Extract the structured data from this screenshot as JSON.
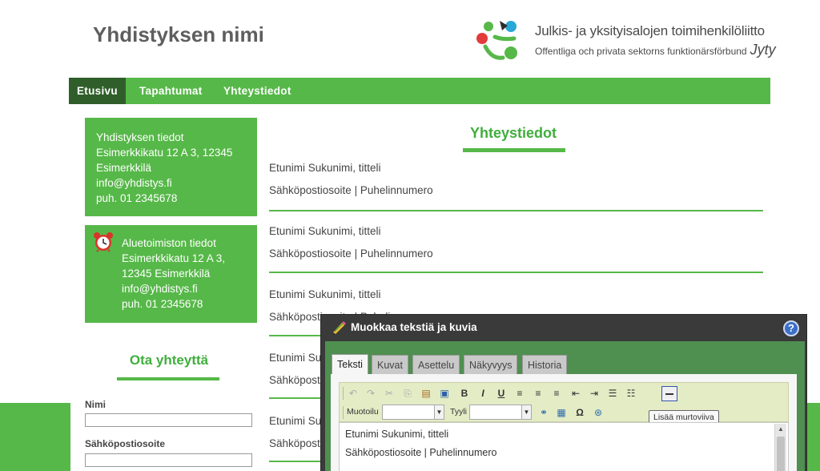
{
  "site": {
    "name": "Yhdistyksen nimi"
  },
  "logo": {
    "line1": "Julkis- ja yksityisalojen toimihenkilöliitto",
    "line2": "Offentliga och privata sektorns funktionärsförbund",
    "brand": "Jyty"
  },
  "nav": {
    "items": [
      "Etusivu",
      "Tapahtumat",
      "Yhteystiedot"
    ]
  },
  "sidebar": {
    "box1": {
      "lines": [
        "Yhdistyksen tiedot",
        "Esimerkkikatu 12 A 3, 12345",
        "Esimerkkilä",
        "info@yhdistys.fi",
        "puh. 01 2345678"
      ]
    },
    "box2": {
      "lines": [
        "Aluetoimiston tiedot",
        "Esimerkkikatu 12 A 3,",
        "12345 Esimerkkilä",
        "info@yhdistys.fi",
        "puh. 01 2345678"
      ]
    },
    "contact_title": "Ota yhteyttä",
    "fields": [
      {
        "label": "Nimi",
        "value": ""
      },
      {
        "label": "Sähköpostiosoite",
        "value": ""
      }
    ]
  },
  "main": {
    "title": "Yhteystiedot",
    "entries": [
      {
        "name": "Etunimi Sukunimi, titteli",
        "contact": "Sähköpostiosoite | Puhelinnumero"
      },
      {
        "name": "Etunimi Sukunimi, titteli",
        "contact": "Sähköpostiosoite | Puhelinnumero"
      },
      {
        "name": "Etunimi Sukunimi, titteli",
        "contact": "Sähköpostiosoite | Puhelinnumero"
      },
      {
        "name": "Etunimi Su",
        "contact": "Sähköpostiosoite"
      },
      {
        "name": "Etunimi Su",
        "contact": "Sähköpost"
      }
    ]
  },
  "editor": {
    "title": "Muokkaa tekstiä ja kuvia",
    "help": "?",
    "tabs": [
      "Teksti",
      "Kuvat",
      "Asettelu",
      "Näkyvyys",
      "Historia"
    ],
    "active_tab": "Teksti",
    "toolbar": {
      "format_label": "Muotoilu",
      "style_label": "Tyyli",
      "tooltip": "Lisää murtoviiva"
    },
    "content": [
      "Etunimi Sukunimi, titteli",
      "Sähköpostiosoite | Puhelinnumero"
    ]
  },
  "colors": {
    "accent": "#56b848",
    "accent_dark": "#2f5e2a",
    "title_green": "#3fae3c",
    "dialog": "#3a3a3a"
  }
}
